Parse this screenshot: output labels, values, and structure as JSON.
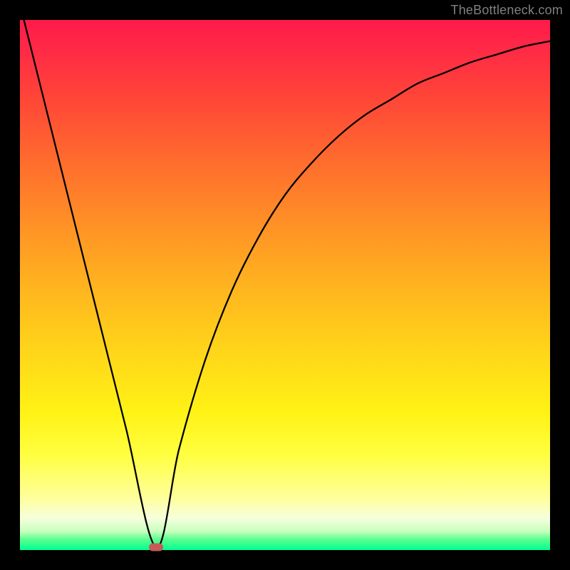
{
  "watermark": "TheBottleneck.com",
  "chart_data": {
    "type": "line",
    "title": "",
    "xlabel": "",
    "ylabel": "",
    "xlim": [
      0,
      100
    ],
    "ylim": [
      0,
      100
    ],
    "series": [
      {
        "name": "bottleneck-curve",
        "x": [
          0,
          5,
          10,
          15,
          20,
          25.7,
          30,
          35,
          40,
          45,
          50,
          55,
          60,
          65,
          70,
          75,
          80,
          85,
          90,
          95,
          100
        ],
        "y": [
          103,
          83,
          63,
          43,
          23,
          0.5,
          19,
          36,
          49,
          59,
          67,
          73,
          78,
          82,
          85,
          88,
          90,
          92,
          93.5,
          95,
          96
        ]
      }
    ],
    "marker": {
      "x": 25.7,
      "y": 0.5
    },
    "gradient_stops": [
      {
        "pct": 0,
        "color": "#ff1a4a"
      },
      {
        "pct": 50,
        "color": "#ffb31f"
      },
      {
        "pct": 82,
        "color": "#ffff40"
      },
      {
        "pct": 100,
        "color": "#00ff93"
      }
    ]
  }
}
